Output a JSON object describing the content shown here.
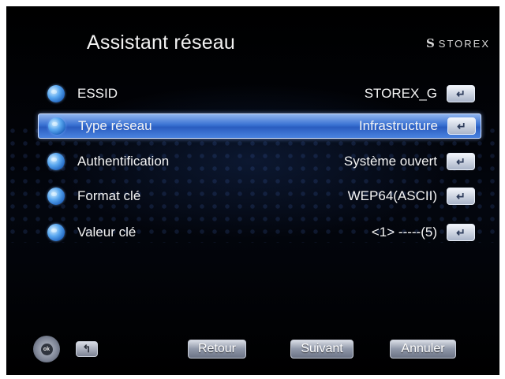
{
  "header": {
    "title": "Assistant réseau",
    "brand": "STOREX",
    "brand_mark": "S"
  },
  "settings": [
    {
      "label": "ESSID",
      "value": "STOREX_G",
      "selected": false
    },
    {
      "label": "Type réseau",
      "value": "Infrastructure",
      "selected": true
    },
    {
      "label": "Authentification",
      "value": "Système ouvert",
      "selected": false
    },
    {
      "label": "Format clé",
      "value": "WEP64(ASCII)",
      "selected": false
    },
    {
      "label": "Valeur clé",
      "value": "<1> -----(5)",
      "selected": false
    }
  ],
  "icons": {
    "row_icon": "globe-icon",
    "enter_icon": "enter-key-icon",
    "enter_glyph": "↵"
  },
  "footer": {
    "nav_ok": "ok",
    "back_glyph": "↰",
    "buttons": [
      "Retour",
      "Suivant",
      "Annuler"
    ]
  },
  "colors": {
    "selection": "#3a72d3",
    "background": "#000000",
    "text": "#f4f4f4"
  }
}
